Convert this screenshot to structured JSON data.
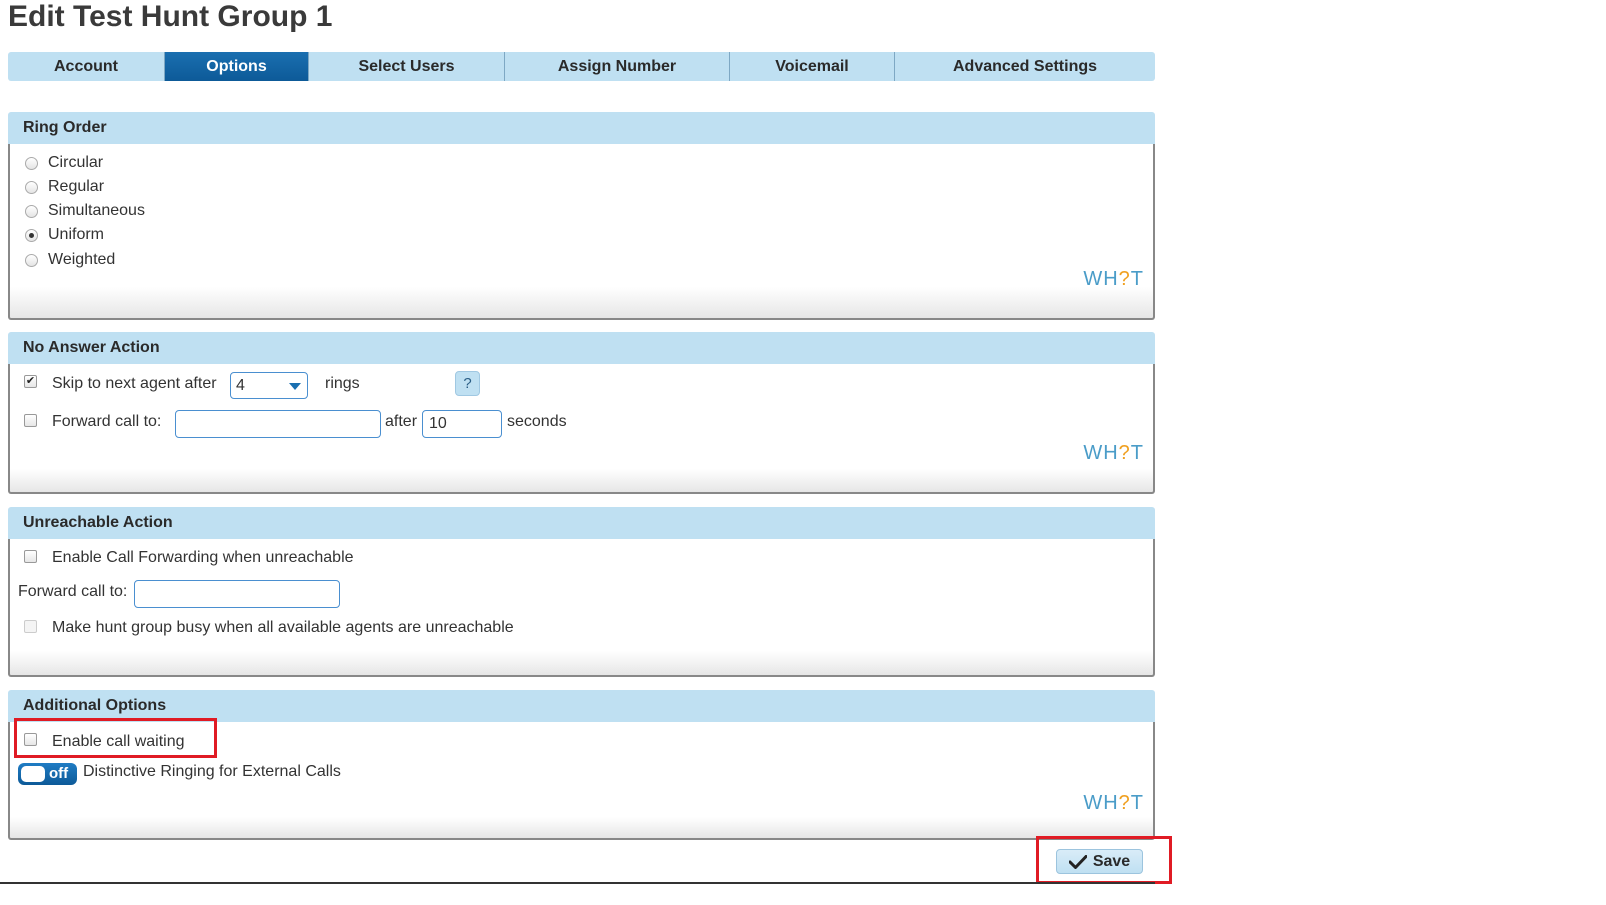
{
  "page": {
    "title": "Edit Test Hunt Group 1"
  },
  "tabs": [
    {
      "label": "Account"
    },
    {
      "label": "Options",
      "active": true
    },
    {
      "label": "Select Users"
    },
    {
      "label": "Assign Number"
    },
    {
      "label": "Voicemail"
    },
    {
      "label": "Advanced Settings"
    }
  ],
  "ring_order": {
    "title": "Ring Order",
    "options": [
      "Circular",
      "Regular",
      "Simultaneous",
      "Uniform",
      "Weighted"
    ],
    "selected": "Uniform"
  },
  "no_answer": {
    "title": "No Answer Action",
    "skip_label": "Skip to next agent after",
    "skip_checked": true,
    "skip_rings_value": "4",
    "rings_label": "rings",
    "help_label": "?",
    "forward_label": "Forward call to:",
    "forward_checked": false,
    "forward_value": "",
    "after_label": "after",
    "seconds_value": "10",
    "seconds_label": "seconds"
  },
  "unreachable": {
    "title": "Unreachable Action",
    "enable_label": "Enable Call Forwarding when unreachable",
    "enable_checked": false,
    "forward_label": "Forward call to:",
    "forward_value": "",
    "busy_label": "Make hunt group busy when all available agents are unreachable",
    "busy_checked": false
  },
  "additional": {
    "title": "Additional Options",
    "call_waiting_label": "Enable call waiting",
    "call_waiting_checked": false,
    "toggle_state": "off",
    "distinctive_label": "Distinctive Ringing for External Calls"
  },
  "branding": {
    "what_prefix": "WH",
    "what_q": "?",
    "what_suffix": "T"
  },
  "actions": {
    "save_label": "Save"
  },
  "colors": {
    "accent": "#0d5a98",
    "tab_bg": "#bfe0f2",
    "highlight": "#e01b24",
    "logo": "#4a9cc8",
    "logo_q": "#f0a020"
  }
}
